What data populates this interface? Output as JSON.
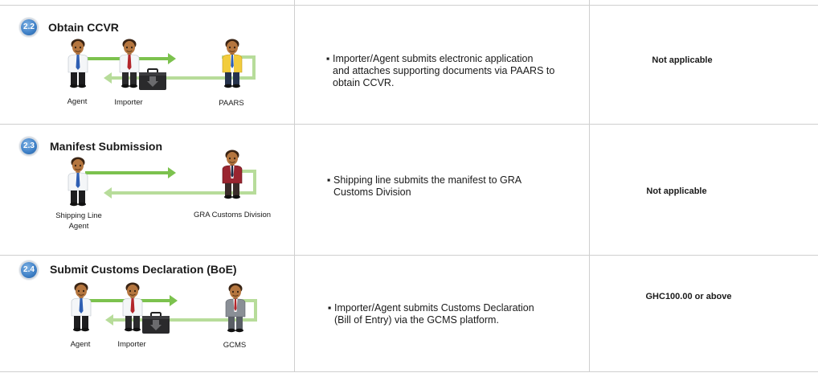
{
  "steps": [
    {
      "number": "2.2",
      "title": "Obtain CCVR",
      "actors": [
        "Agent",
        "Importer",
        "PAARS"
      ],
      "description_lines": [
        "Importer/Agent submits electronic application",
        "and attaches supporting documents via PAARS to",
        "obtain CCVR."
      ],
      "fee": "Not applicable"
    },
    {
      "number": "2.3",
      "title": "Manifest Submission",
      "actors": [
        "Shipping Line\nAgent",
        "GRA Customs Division"
      ],
      "description_lines": [
        "Shipping line submits the manifest to GRA",
        "Customs Division"
      ],
      "fee": "Not applicable"
    },
    {
      "number": "2.4",
      "title": "Submit Customs Declaration (BoE)",
      "actors": [
        "Agent",
        "Importer",
        "GCMS"
      ],
      "description_lines": [
        "Importer/Agent submits Customs Declaration",
        "(Bill of Entry) via the GCMS platform."
      ],
      "fee": "GHC100.00 or above"
    }
  ],
  "bullet": "▪",
  "colors": {
    "arrow_dark": "#7cc24e",
    "arrow_light": "#b7dc9a",
    "grid": "#cfcfcf",
    "badge": "#3d7fc6"
  },
  "icons": [
    "person-agent-icon",
    "person-importer-icon",
    "briefcase-icon",
    "person-official-icon",
    "arrow-right-icon",
    "arrow-left-icon"
  ]
}
